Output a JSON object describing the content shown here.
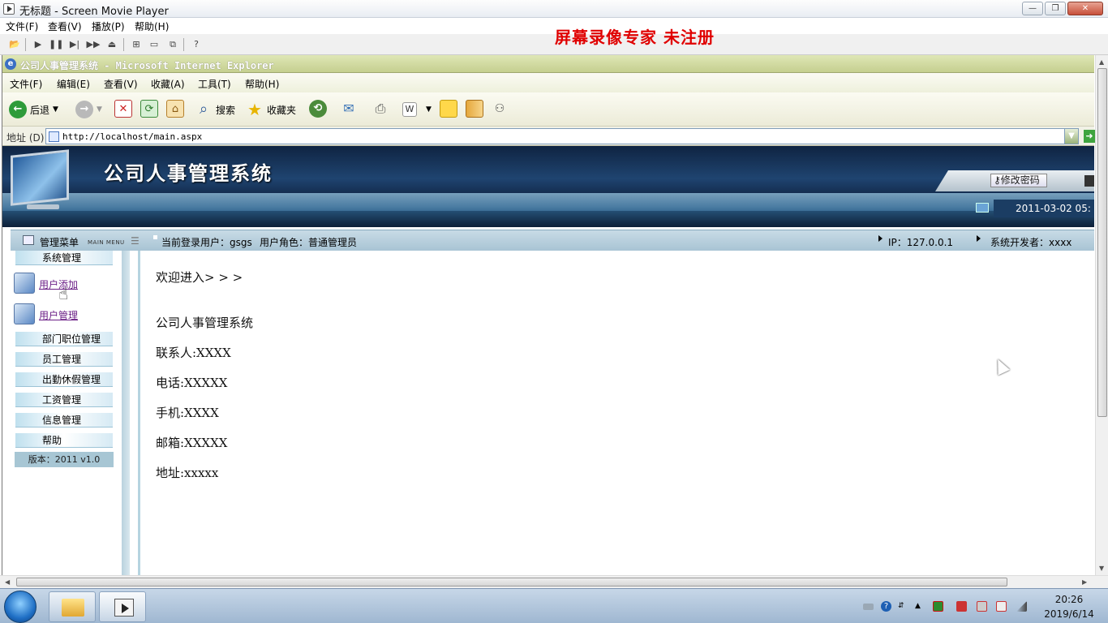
{
  "player": {
    "title": "无标题 - Screen Movie Player",
    "menu": [
      "文件(F)",
      "查看(V)",
      "播放(P)",
      "帮助(H)"
    ],
    "watermark": "屏幕录像专家  未注册"
  },
  "ie": {
    "title": "公司人事管理系统 - Microsoft Internet Explorer",
    "menu": [
      "文件(F)",
      "编辑(E)",
      "查看(V)",
      "收藏(A)",
      "工具(T)",
      "帮助(H)"
    ],
    "toolbar": {
      "back": "后退",
      "search": "搜索",
      "favorites": "收藏夹"
    },
    "address_label": "地址 (D)",
    "address": "http://localhost/main.aspx"
  },
  "banner": {
    "title": "公司人事管理系统",
    "change_password": "修改密码",
    "datetime": "2011-03-02 05:"
  },
  "info_bar": {
    "menu_title": "管理菜单",
    "menu_sub": "MAIN MENU",
    "user_label": "当前登录用户：gsgs",
    "role_label": "用户角色：普通管理员",
    "ip": "IP：127.0.0.1",
    "developer": "系统开发者：xxxx"
  },
  "sidebar": {
    "system_section": "系统管理",
    "links": [
      "用户添加",
      "用户管理"
    ],
    "sections": [
      "部门职位管理",
      "员工管理",
      "出勤休假管理",
      "工资管理",
      "信息管理",
      "帮助"
    ],
    "version": "版本：2011 v1.0"
  },
  "content": {
    "welcome": "欢迎进入> > >",
    "company": "公司人事管理系统",
    "contact": "联系人:XXXX",
    "phone": "电话:XXXXX",
    "mobile": "手机:XXXX",
    "email": "邮箱:XXXXX",
    "address": "地址:xxxxx"
  },
  "taskbar": {
    "time": "20:26",
    "date": "2019/6/14"
  }
}
